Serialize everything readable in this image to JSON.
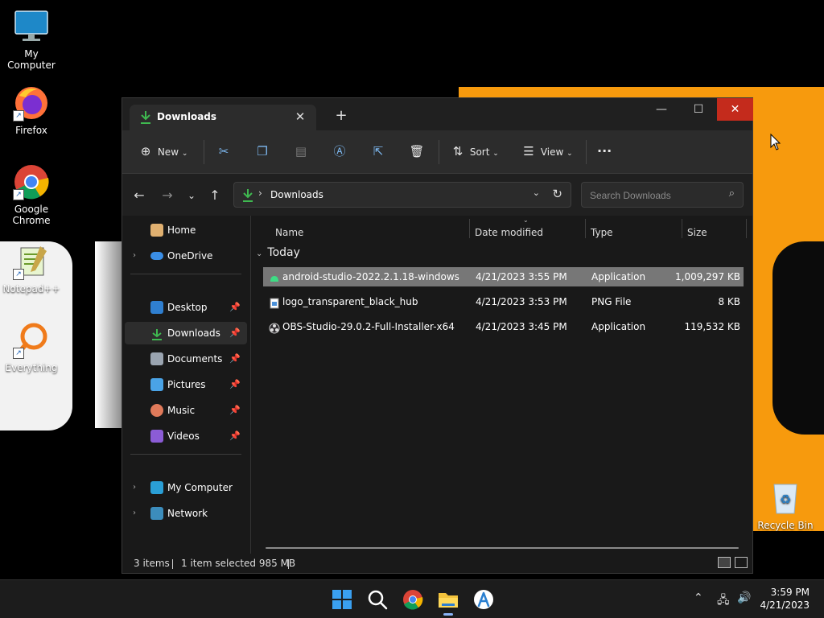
{
  "desktop": {
    "icons": [
      {
        "label": "My Computer"
      },
      {
        "label": "Firefox"
      },
      {
        "label": "Google\nChrome"
      },
      {
        "label": "Notepad++"
      },
      {
        "label": "Everything"
      }
    ],
    "recycle_bin": "Recycle Bin"
  },
  "window": {
    "tab_title": "Downloads",
    "new_tab": "+",
    "controls": {
      "minimize": "—",
      "maximize": "☐",
      "close": "✕"
    }
  },
  "toolbar": {
    "new_label": "New",
    "sort_label": "Sort",
    "view_label": "View",
    "more_label": "···"
  },
  "address": {
    "path": "Downloads",
    "search_placeholder": "Search Downloads"
  },
  "sidebar": {
    "items": [
      {
        "label": "Home"
      },
      {
        "label": "OneDrive"
      },
      {
        "label": "Desktop"
      },
      {
        "label": "Downloads"
      },
      {
        "label": "Documents"
      },
      {
        "label": "Pictures"
      },
      {
        "label": "Music"
      },
      {
        "label": "Videos"
      },
      {
        "label": "My Computer"
      },
      {
        "label": "Network"
      }
    ]
  },
  "columns": {
    "name": "Name",
    "date": "Date modified",
    "type": "Type",
    "size": "Size"
  },
  "group": "Today",
  "files": [
    {
      "name": "android-studio-2022.2.1.18-windows",
      "date": "4/21/2023 3:55 PM",
      "type": "Application",
      "size": "1,009,297 KB"
    },
    {
      "name": "logo_transparent_black_hub",
      "date": "4/21/2023 3:53 PM",
      "type": "PNG File",
      "size": "8 KB"
    },
    {
      "name": "OBS-Studio-29.0.2-Full-Installer-x64",
      "date": "4/21/2023 3:45 PM",
      "type": "Application",
      "size": "119,532 KB"
    }
  ],
  "status": {
    "items": "3 items",
    "selected": "1 item selected  985 MB"
  },
  "taskbar": {
    "time": "3:59 PM",
    "date": "4/21/2023"
  },
  "colors": {
    "close_red": "#c42b1c",
    "selection": "#777777",
    "download_green": "#3fb950",
    "wallpaper_orange": "#f79a0d"
  }
}
